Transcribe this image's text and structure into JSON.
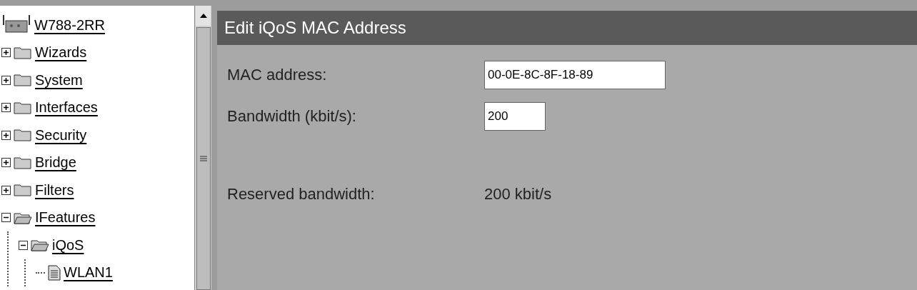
{
  "tree": {
    "root": {
      "label": "W788-2RR"
    },
    "items": [
      {
        "label": "Wizards",
        "kind": "folder",
        "expanded": false
      },
      {
        "label": "System",
        "kind": "folder",
        "expanded": false
      },
      {
        "label": "Interfaces",
        "kind": "folder",
        "expanded": false
      },
      {
        "label": "Security",
        "kind": "folder",
        "expanded": false
      },
      {
        "label": "Bridge",
        "kind": "folder",
        "expanded": false
      },
      {
        "label": "Filters",
        "kind": "folder",
        "expanded": false
      },
      {
        "label": "IFeatures",
        "kind": "folder",
        "expanded": true,
        "children": [
          {
            "label": "iQoS",
            "kind": "folder",
            "expanded": true,
            "children": [
              {
                "label": "WLAN1",
                "kind": "page"
              }
            ]
          }
        ]
      }
    ]
  },
  "panel": {
    "title": "Edit iQoS MAC Address",
    "fields": [
      {
        "label": "MAC address:",
        "value": "00-0E-8C-8F-18-89",
        "kind": "wide"
      },
      {
        "label": "Bandwidth (kbit/s):",
        "value": "200",
        "kind": "narrow"
      }
    ],
    "readouts": [
      {
        "label": "Reserved bandwidth:",
        "value": "200 kbit/s"
      }
    ]
  }
}
